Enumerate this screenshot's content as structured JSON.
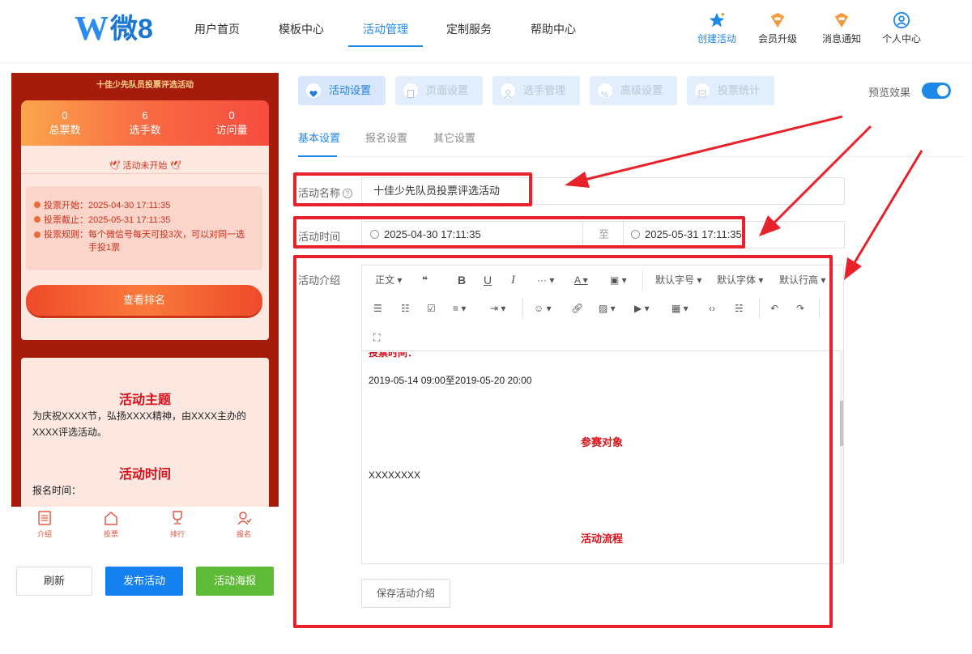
{
  "brand": {
    "logo_mark": "W",
    "logo_text": "微8"
  },
  "nav": {
    "items": [
      {
        "label": "用户首页"
      },
      {
        "label": "模板中心"
      },
      {
        "label": "活动管理"
      },
      {
        "label": "定制服务"
      },
      {
        "label": "帮助中心"
      }
    ],
    "active": "活动管理"
  },
  "top_actions": [
    {
      "label": "创建活动",
      "icon": "star-icon",
      "color": "#1e88e5"
    },
    {
      "label": "会员升级",
      "icon": "member-badge-icon",
      "color": "#f39a3d"
    },
    {
      "label": "消息通知",
      "icon": "message-badge-icon",
      "color": "#f39a3d"
    },
    {
      "label": "个人中心",
      "icon": "user-circle-icon",
      "color": "#1e88e5"
    }
  ],
  "preview": {
    "title": "十佳少先队员投票评选活动",
    "stats": [
      {
        "value": "0",
        "label": "总票数"
      },
      {
        "value": "6",
        "label": "选手数"
      },
      {
        "value": "0",
        "label": "访问量"
      }
    ],
    "status": "活动未开始",
    "info": [
      {
        "label": "投票开始：",
        "value": "2025-04-30 17:11:35"
      },
      {
        "label": "投票截止：",
        "value": "2025-05-31 17:11:35"
      },
      {
        "label": "投票规则：",
        "value": "每个微信号每天可投3次，可以对同一选手投1票"
      }
    ],
    "rank_button": "查看排名",
    "sections": {
      "theme_title": "活动主题",
      "theme_text": "为庆祝XXXX节，弘扬XXXX精神，由XXXX主办的XXXX评选活动。",
      "time_title": "活动时间",
      "time_text": "报名时间："
    },
    "tabbar": [
      {
        "label": "介绍",
        "icon": "document-icon"
      },
      {
        "label": "投票",
        "icon": "home-icon"
      },
      {
        "label": "排行",
        "icon": "trophy-icon"
      },
      {
        "label": "报名",
        "icon": "signup-icon"
      }
    ]
  },
  "actions": {
    "refresh": "刷新",
    "publish": "发布活动",
    "poster": "活动海报"
  },
  "panel_tabs": [
    {
      "label": "活动设置",
      "icon": "heart-icon"
    },
    {
      "label": "页面设置",
      "icon": "page-icon"
    },
    {
      "label": "选手管理",
      "icon": "person-icon"
    },
    {
      "label": "高级设置",
      "icon": "percent-icon"
    },
    {
      "label": "投票统计",
      "icon": "chart-icon"
    }
  ],
  "preview_toggle": {
    "label": "预览效果",
    "on": true
  },
  "sub_tabs": [
    {
      "label": "基本设置"
    },
    {
      "label": "报名设置"
    },
    {
      "label": "其它设置"
    }
  ],
  "form": {
    "name_label": "活动名称",
    "name_value": "十佳少先队员投票评选活动",
    "time_label": "活动时间",
    "start": "2025-04-30 17:11:35",
    "to": "至",
    "end": "2025-05-31 17:11:35",
    "intro_label": "活动介绍",
    "save_button": "保存活动介绍"
  },
  "editor": {
    "toolbar": {
      "paragraph": "正文",
      "font_size": "默认字号",
      "font_family": "默认字体",
      "line_height": "默认行高"
    },
    "content": {
      "cut_heading": "投票时间：",
      "vote_time": "2019-05-14 09:00至2019-05-20 20:00",
      "h_participants": "参赛对象",
      "participants": "XXXXXXXX",
      "h_process": "活动流程"
    }
  },
  "colors": {
    "accent": "#1e88e5",
    "annotation": "#e8222a",
    "preview_bg": "#a51c0c"
  }
}
